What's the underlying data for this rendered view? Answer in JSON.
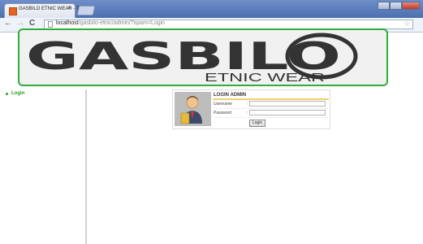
{
  "browser": {
    "tab_title": "GASBILO ETNIC WEAR - T",
    "tab_close": "×",
    "url_host": "localhost",
    "url_path": "/gasbilo-etnic/admin/?spam=Login",
    "back_glyph": "←",
    "forward_glyph": "→",
    "reload_glyph": "C",
    "star_glyph": "☆"
  },
  "banner": {
    "logo_main": "GASBILO",
    "logo_sub": "ETNIC WEAR",
    "accent_color": "#2fae3b"
  },
  "sidebar": {
    "items": [
      {
        "label": "Login"
      }
    ]
  },
  "login": {
    "title": "LOGIN ADMIN",
    "username_label": "Username",
    "password_label": "Password",
    "colon": ":",
    "button_label": "Login"
  },
  "icons": [
    "back-icon",
    "forward-icon",
    "reload-icon",
    "page-icon",
    "star-icon",
    "admin-avatar-icon"
  ]
}
